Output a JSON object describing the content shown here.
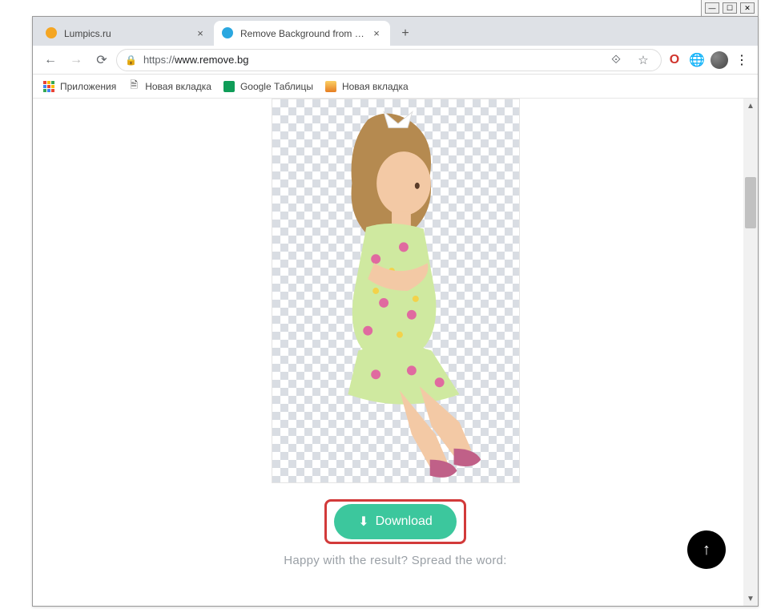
{
  "window_controls": {
    "min": "—",
    "max": "☐",
    "close": "✕"
  },
  "tabs": [
    {
      "title": "Lumpics.ru",
      "icon_color": "#f5a623",
      "active": false
    },
    {
      "title": "Remove Background from Image",
      "icon_color": "#2aa7e0",
      "active": true
    }
  ],
  "toolbar": {
    "back": "←",
    "forward": "→",
    "reload": "⟳",
    "url_prefix": "https://",
    "url_host": "www.remove.bg",
    "translate": "⟐",
    "star": "☆",
    "opera": "O",
    "globe": "🌐",
    "menu": "⋮"
  },
  "bookmarks": [
    {
      "label": "Приложения",
      "kind": "apps"
    },
    {
      "label": "Новая вкладка",
      "kind": "page"
    },
    {
      "label": "Google Таблицы",
      "kind": "sheets"
    },
    {
      "label": "Новая вкладка",
      "kind": "img"
    }
  ],
  "page": {
    "download_label": "Download",
    "download_icon": "⬇",
    "caption": "Happy with the result? Spread the word:",
    "fab_icon": "↑"
  },
  "scrollbar": {
    "up": "▲",
    "down": "▼"
  }
}
